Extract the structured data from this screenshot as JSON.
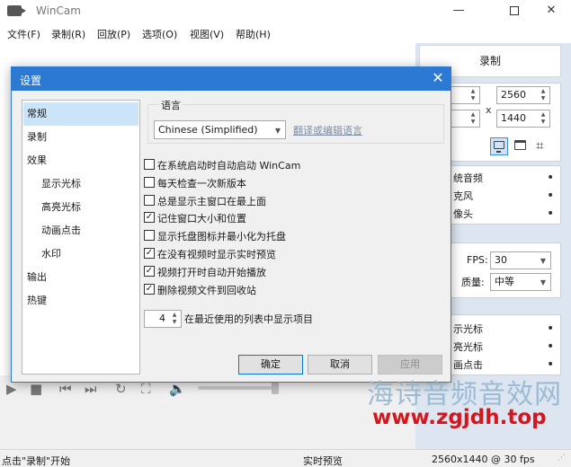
{
  "app": {
    "title": "WinCam"
  },
  "menu": [
    {
      "label": "文件(F)"
    },
    {
      "label": "录制(R)"
    },
    {
      "label": "回放(P)"
    },
    {
      "label": "选项(O)"
    },
    {
      "label": "视图(V)"
    },
    {
      "label": "帮助(H)"
    }
  ],
  "side_panel": {
    "record_label": "录制",
    "width_value": "2560",
    "height_value": "1440",
    "times_sign": "x",
    "audio_items": [
      "统音频",
      "克风",
      "像头"
    ],
    "fps_label": "FPS:",
    "fps_value": "30",
    "quality_label": "质量:",
    "quality_value": "中等",
    "effects_items": [
      "示光标",
      "亮光标",
      "画点击"
    ]
  },
  "dialog": {
    "title": "设置",
    "nav": [
      {
        "label": "常规",
        "active": true
      },
      {
        "label": "录制"
      },
      {
        "label": "效果"
      },
      {
        "label": "显示光标",
        "sub": true
      },
      {
        "label": "高亮光标",
        "sub": true
      },
      {
        "label": "动画点击",
        "sub": true
      },
      {
        "label": "水印",
        "sub": true
      },
      {
        "label": "输出"
      },
      {
        "label": "热键"
      }
    ],
    "language": {
      "group_label": "语言",
      "selected": "Chinese (Simplified)",
      "link": "翻译或编辑语言"
    },
    "options": [
      {
        "label": "在系统启动时自动启动 WinCam",
        "checked": false
      },
      {
        "label": "每天检查一次新版本",
        "checked": false
      },
      {
        "label": "总是显示主窗口在最上面",
        "checked": false
      },
      {
        "label": "记住窗口大小和位置",
        "checked": true
      },
      {
        "label": "显示托盘图标并最小化为托盘",
        "checked": false
      },
      {
        "label": "在没有视频时显示实时预览",
        "checked": true
      },
      {
        "label": "视频打开时自动开始播放",
        "checked": true
      },
      {
        "label": "删除视频文件到回收站",
        "checked": true
      }
    ],
    "recent_count": "4",
    "recent_label": "在最近使用的列表中显示项目",
    "buttons": {
      "ok": "确定",
      "cancel": "取消",
      "apply": "应用"
    }
  },
  "status": {
    "hint": "点击\"录制\"开始",
    "mode": "实时预览",
    "info": "2560x1440 @ 30 fps"
  },
  "watermark": {
    "line1": "海诗音频音效网",
    "line2": "www.zgjdh.top"
  },
  "colors": {
    "dialog_title_bg": "#2b79d2",
    "nav_active_bg": "#cce4f7",
    "side_panel_bg": "#dde6f0",
    "watermark_red": "#d4171f"
  }
}
